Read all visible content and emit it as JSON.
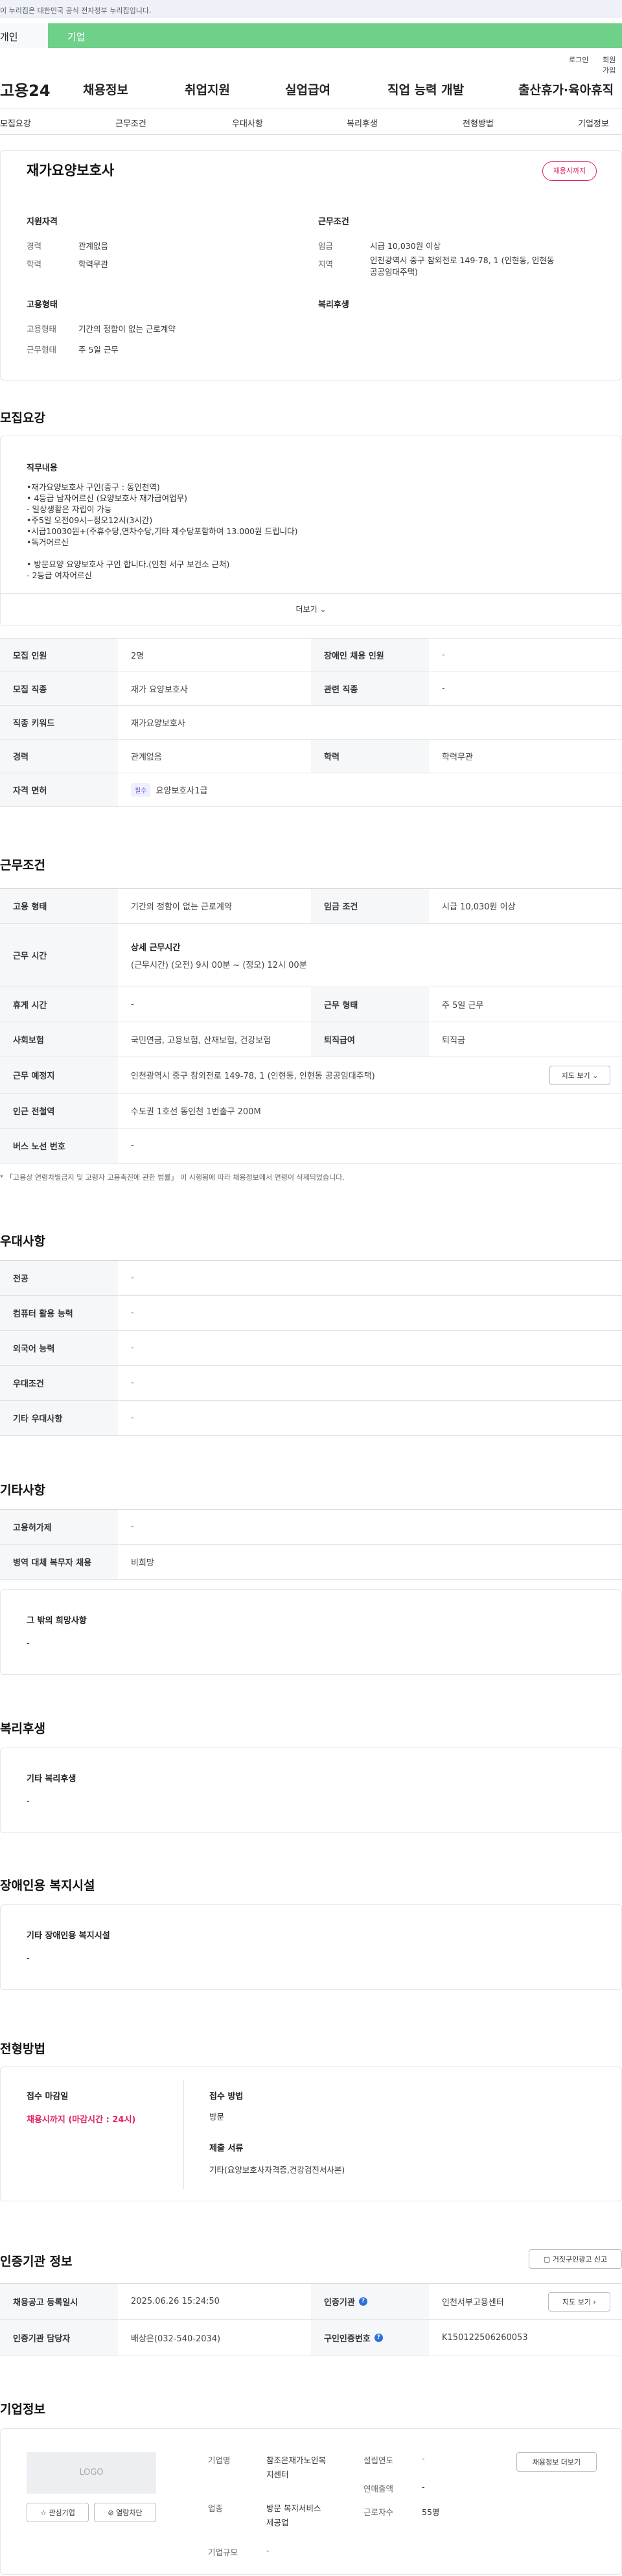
{
  "banner": {
    "text": "이 누리집은 대한민국 공식 전자정부 누리집입니다."
  },
  "audience": {
    "person": "개인",
    "company": "기업"
  },
  "util": {
    "login": "로그인",
    "signup": "회원가입"
  },
  "gnb": {
    "logo": "고용24",
    "items": [
      "채용정보",
      "취업지원",
      "실업급여",
      "직업 능력 개발",
      "출산휴가·육아휴직"
    ]
  },
  "subtabs": [
    "모집요강",
    "근무조건",
    "우대사항",
    "복리후생",
    "전형방법",
    "기업정보"
  ],
  "summary": {
    "title": "재가요양보호사",
    "badge": "채용시까지",
    "qual_head": "지원자격",
    "career_label": "경력",
    "career_value": "관계없음",
    "edu_label": "학력",
    "edu_value": "학력무관",
    "emp_head": "고용형태",
    "emp_label": "고용형태",
    "emp_value": "기간의 정함이 없는 근로계약",
    "work_label": "근무형태",
    "work_value": "주 5일 근무",
    "cond_head": "근무조건",
    "wage_label": "임금",
    "wage_value": "시급 10,030원 이상",
    "region_label": "지역",
    "region_value_1": "인천광역시 중구 참외전로 149-78, 1 (인현동, 인현동",
    "region_value_2": "공공임대주택)",
    "welfare_head": "복리후생"
  },
  "recruit": {
    "title": "모집요강",
    "duty_head": "직무내용",
    "duty_lines": [
      "•재가요양보호사 구인(중구 : 동인천역)",
      "• 4등급 남자어르신   (요양보호사 재가급여업무)",
      "- 일상생활은 자립이 가능",
      "•주5일 오전09시~정오12시(3시간)",
      "•시급10030원+(주휴수당,연차수당,기타 제수당포함하여 13.000원 드립니다)",
      "•독거어르신",
      "",
      "• 방문요양 요양보호사 구인 합니다.(인천 서구 보건소 근처)",
      "- 2등급 여자어르신"
    ],
    "more": "더보기",
    "rows": {
      "count_label": "모집 인원",
      "count_value": "2명",
      "disabled_label": "장애인 채용 인원",
      "disabled_value": "-",
      "job_label": "모집 직종",
      "job_value": "재가 요양보호사",
      "related_label": "관련 직종",
      "related_value": "-",
      "keyword_label": "직종 키워드",
      "keyword_value": "재가요양보호사",
      "career_label": "경력",
      "career_value": "관계없음",
      "edu_label": "학력",
      "edu_value": "학력무관",
      "license_label": "자격 면허",
      "license_tag": "필수",
      "license_value": "요양보호사1급"
    }
  },
  "work": {
    "title": "근무조건",
    "emp_label": "고용 형태",
    "emp_value": "기간의 정함이 없는 근로계약",
    "wage_label": "임금 조건",
    "wage_value": "시급 10,030원 이상",
    "hours_label": "근무 시간",
    "hours_head": "상세 근무시간",
    "hours_value": "(근무시간) (오전) 9시 00분 ~ (정오) 12시 00분",
    "rest_label": "휴게 시간",
    "rest_value": "-",
    "type_label": "근무 형태",
    "type_value": "주 5일 근무",
    "insurance_label": "사회보험",
    "insurance_value": "국민연금, 고용보험, 산재보험, 건강보험",
    "retire_label": "퇴직급여",
    "retire_value": "퇴직금",
    "place_label": "근무 예정지",
    "place_value": "인천광역시 중구 참외전로 149-78, 1 (인현동, 인현동 공공임대주택)",
    "map_btn": "지도 보기",
    "subway_label": "인근 전철역",
    "subway_value": "수도권 1호선 동인천 1번출구 200M",
    "bus_label": "버스 노선 번호",
    "bus_value": "-",
    "note": "* 「고용상 연령차별금지 및 고령자 고용촉진에 관한 법률」 이 시행됨에 따라 채용정보에서 연령이 삭제되었습니다."
  },
  "pref": {
    "title": "우대사항",
    "rows": [
      {
        "label": "전공",
        "value": "-"
      },
      {
        "label": "컴퓨터 활용 능력",
        "value": "-"
      },
      {
        "label": "외국어 능력",
        "value": "-"
      },
      {
        "label": "우대조건",
        "value": "-"
      },
      {
        "label": "기타 우대사항",
        "value": "-"
      }
    ]
  },
  "etc": {
    "title": "기타사항",
    "rows": [
      {
        "label": "고용허가제",
        "value": "-"
      },
      {
        "label": "병역 대체 복무자 채용",
        "value": "비희망"
      }
    ],
    "hope_head": "그 밖의 희망사항",
    "hope_value": "-"
  },
  "welfare": {
    "title": "복리후생",
    "head": "기타 복리후생",
    "value": "-"
  },
  "disabled_fac": {
    "title": "장애인용 복지시설",
    "head": "기타 장애인용 복지시설",
    "value": "-"
  },
  "selection": {
    "title": "전형방법",
    "deadline_head": "접수 마감일",
    "deadline_value": "채용시까지 (마감시간 : 24시)",
    "method_head": "접수 방법",
    "method_value": "방문",
    "docs_head": "제출 서류",
    "docs_value": "기타(요양보호사자격증,건강검진서사본)"
  },
  "agency": {
    "title": "인증기관 정보",
    "report_btn": "거짓구인광고 신고",
    "reg_label": "채용공고 등록일시",
    "reg_value": "2025.06.26 15:24:50",
    "org_label": "인증기관",
    "org_value": "인천서부고용센터",
    "manager_label": "인증기관 담당자",
    "manager_value": "배상은(032-540-2034)",
    "cert_label": "구인인증번호",
    "cert_value": "K150122506260053",
    "map_btn": "지도 보기"
  },
  "company": {
    "title": "기업정보",
    "logo": "LOGO",
    "fav_btn": "관심기업",
    "block_btn": "열람차단",
    "info_btn": "채용정보 더보기",
    "name_label": "기업명",
    "name_value_1": "참조은재가노인복",
    "name_value_2": "지센터",
    "year_label": "설립연도",
    "year_value": "-",
    "sales_label": "연매출액",
    "sales_value": "-",
    "ind_label": "업종",
    "ind_value_1": "방문 복지서비스",
    "ind_value_2": "제공업",
    "emp_label": "근로자수",
    "emp_value": "55명",
    "size_label": "기업규모",
    "size_value": "-"
  }
}
